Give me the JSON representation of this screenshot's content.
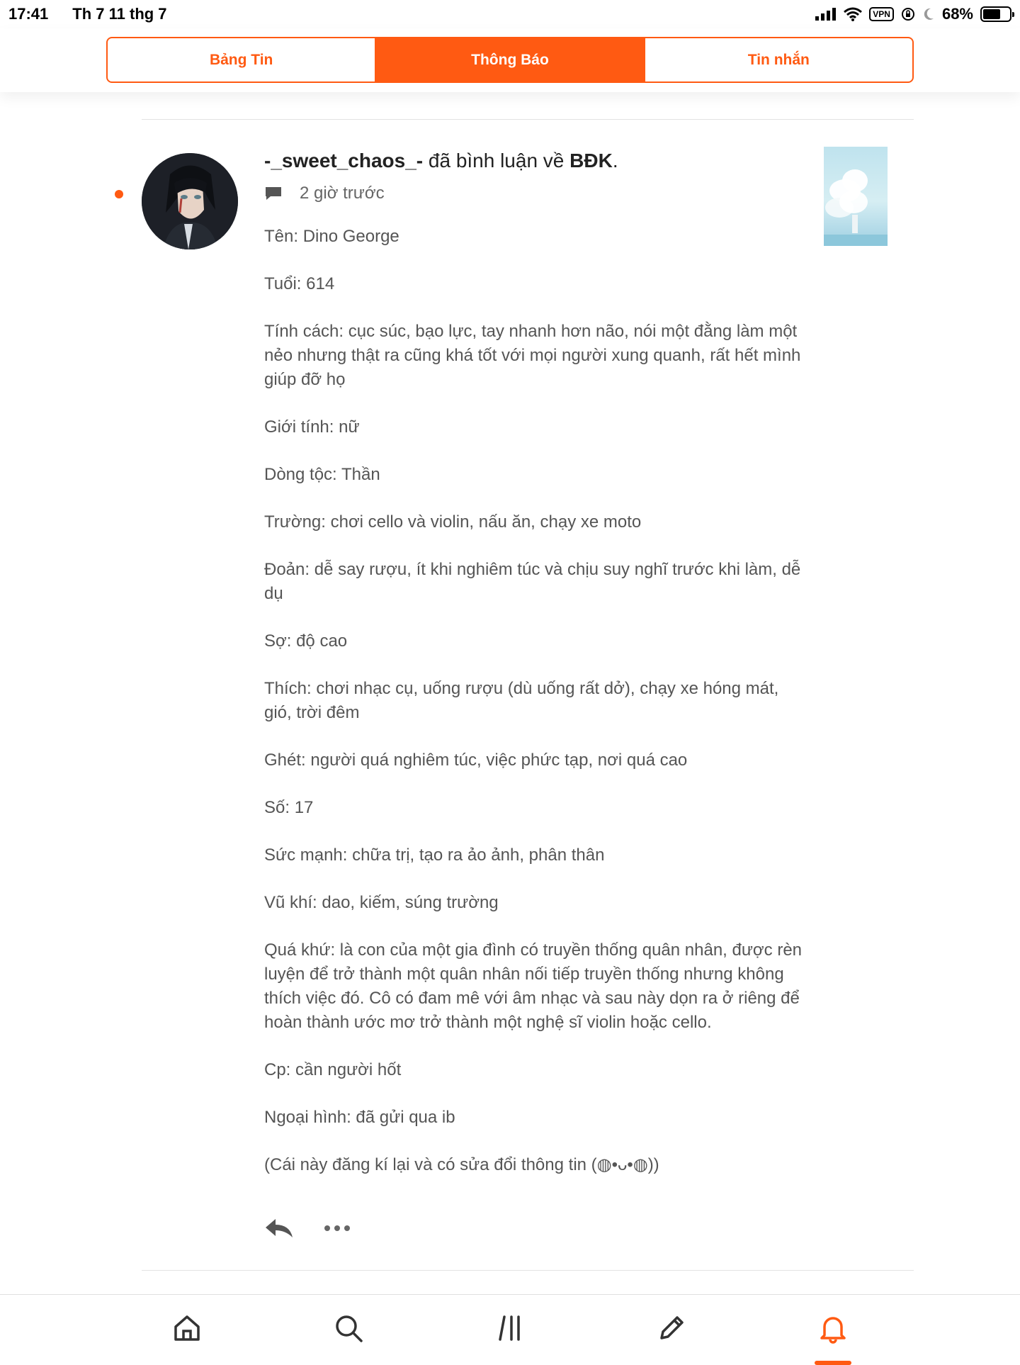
{
  "status_bar": {
    "time": "17:41",
    "date": "Th 7 11 thg 7",
    "vpn_label": "VPN",
    "battery": "68%",
    "battery_level": 0.68
  },
  "tabs": [
    {
      "label": "Bảng Tin",
      "active": false
    },
    {
      "label": "Thông Báo",
      "active": true
    },
    {
      "label": "Tin nhắn",
      "active": false
    }
  ],
  "notification": {
    "username": "-_sweet_chaos_-",
    "action": " đã bình luận về ",
    "target": "BĐK",
    "end": ".",
    "time_ago": "2 giờ trước",
    "unread": true,
    "paragraphs": [
      "Tên: Dino George",
      "Tuổi: 614",
      "Tính cách: cục súc, bạo lực, tay nhanh hơn não, nói một đằng làm một nẻo nhưng thật ra cũng khá tốt với mọi người xung quanh, rất hết mình giúp đỡ họ",
      "Giới tính: nữ",
      "Dòng tộc: Thần",
      "Trường: chơi cello và violin, nấu ăn, chạy xe moto",
      "Đoản: dễ say rượu, ít khi nghiêm túc và chịu suy nghĩ trước khi làm, dễ dụ",
      "Sợ: độ cao",
      "Thích: chơi nhạc cụ, uống rượu (dù uống rất dở), chạy xe hóng mát, gió, trời đêm",
      "Ghét: người quá nghiêm túc, việc phức tạp, nơi quá cao",
      "Số: 17",
      "Sức mạnh: chữa trị, tạo ra ảo ảnh, phân thân",
      "Vũ khí: dao, kiếm, súng trường",
      "Quá khứ: là con của một gia đình có truyền thống quân nhân, được rèn luyện để trở thành một quân nhân nối tiếp truyền thống nhưng không thích việc đó. Cô có đam mê với âm nhạc và sau này dọn ra ở riêng để hoàn thành ước mơ trở thành một nghệ sĩ violin hoặc cello.",
      "Cp: cần người hốt",
      "Ngoại hình: đã gửi qua ib",
      "(Cái này đăng kí lại và có sửa đổi thông tin (◍•ᴗ•◍))"
    ]
  },
  "icons": {
    "reply": "reply-icon",
    "more": "more-icon",
    "comment": "comment-icon"
  },
  "bottom_nav": [
    "home-icon",
    "search-icon",
    "library-icon",
    "write-icon",
    "notifications-icon"
  ],
  "colors": {
    "accent": "#ff5a12"
  }
}
